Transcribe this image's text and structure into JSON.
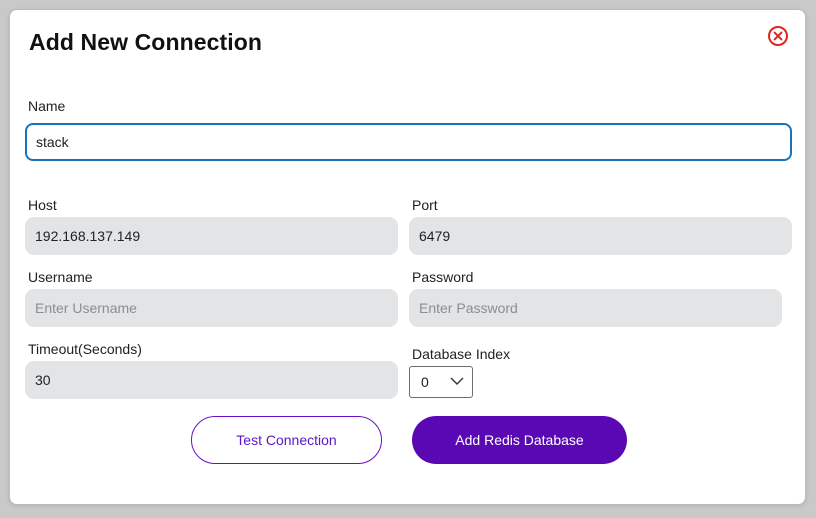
{
  "dialog": {
    "title": "Add New Connection",
    "close_icon": "close-circle-icon"
  },
  "form": {
    "name": {
      "label": "Name",
      "value": "stack",
      "placeholder": ""
    },
    "host": {
      "label": "Host",
      "value": "192.168.137.149",
      "placeholder": ""
    },
    "port": {
      "label": "Port",
      "value": "6479",
      "placeholder": ""
    },
    "username": {
      "label": "Username",
      "value": "",
      "placeholder": "Enter Username"
    },
    "password": {
      "label": "Password",
      "value": "",
      "placeholder": "Enter Password"
    },
    "timeout": {
      "label": "Timeout(Seconds)",
      "value": "30",
      "placeholder": ""
    },
    "database_index": {
      "label": "Database Index",
      "selected": "0",
      "icon": "chevron-down-icon"
    }
  },
  "actions": {
    "test_label": "Test Connection",
    "add_label": "Add Redis Database"
  },
  "colors": {
    "accent": "#5a08b4",
    "focus_border": "#1a73b8",
    "close": "#e0251f"
  }
}
